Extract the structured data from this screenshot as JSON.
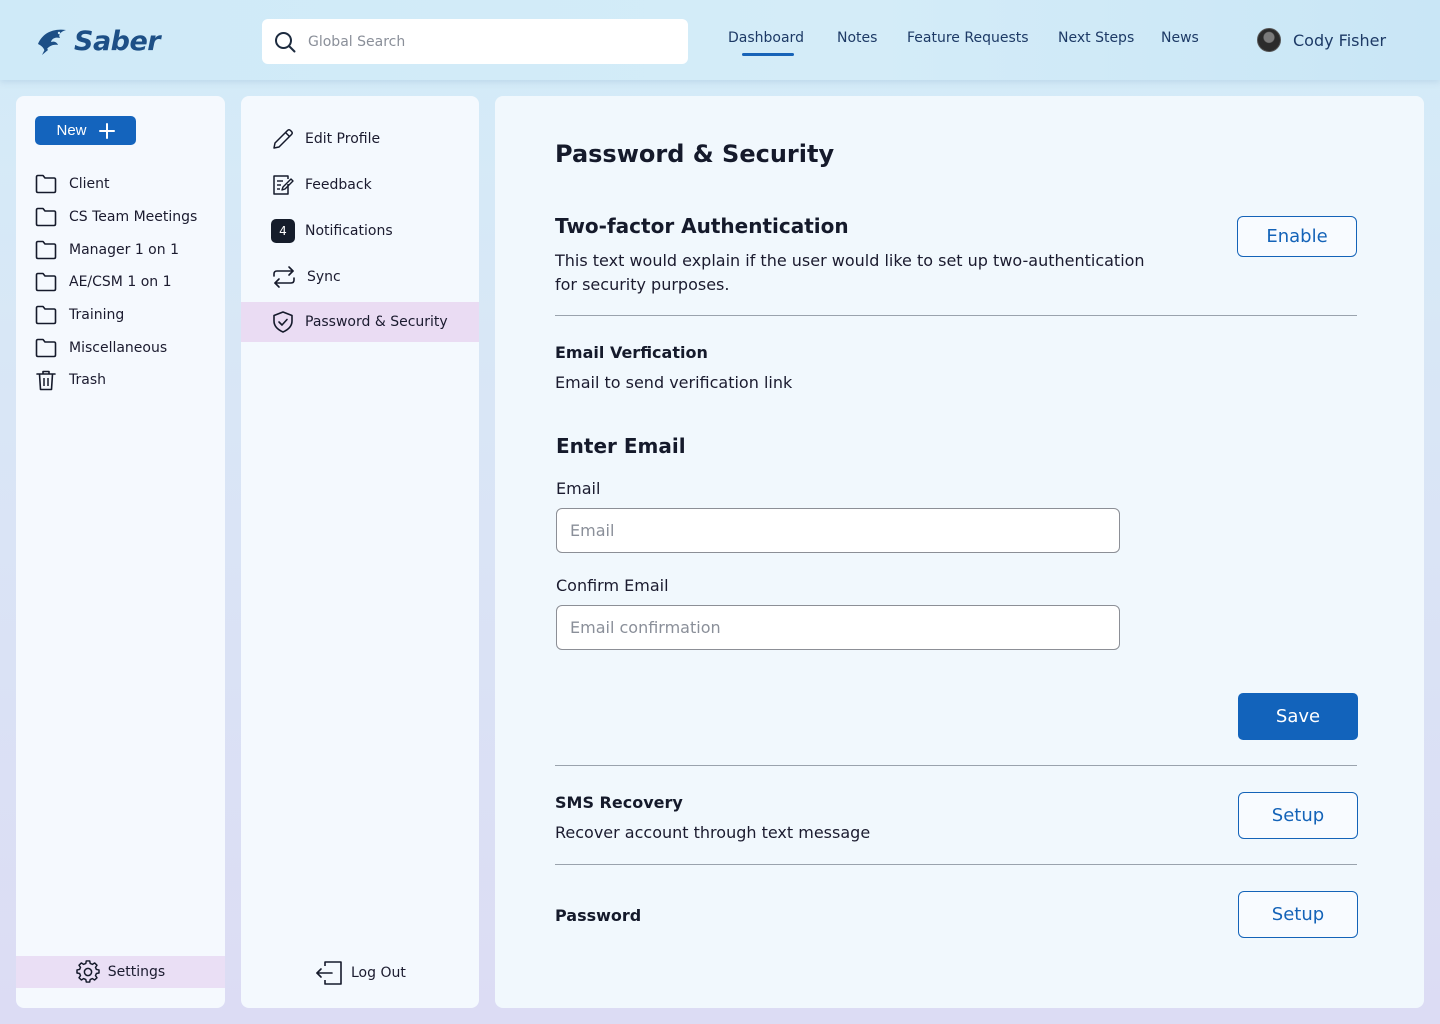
{
  "app": {
    "logo_text": "Saber",
    "brand_color": "#1d4f86",
    "accent_color": "#1464bd"
  },
  "search": {
    "placeholder": "Global Search",
    "icon": "search-icon"
  },
  "nav": {
    "items": [
      {
        "label": "Dashboard",
        "active": true
      },
      {
        "label": "Notes"
      },
      {
        "label": "Feature Requests"
      },
      {
        "label": "Next Steps"
      },
      {
        "label": "News"
      }
    ]
  },
  "user": {
    "name": "Cody Fisher"
  },
  "sidebar": {
    "new_label": "New",
    "folders": [
      {
        "label": "Client",
        "icon": "folder-icon"
      },
      {
        "label": "CS Team Meetings",
        "icon": "folder-icon"
      },
      {
        "label": "Manager 1 on 1",
        "icon": "folder-icon"
      },
      {
        "label": "AE/CSM 1 on 1",
        "icon": "folder-icon"
      },
      {
        "label": "Training",
        "icon": "folder-icon"
      },
      {
        "label": "Miscellaneous",
        "icon": "folder-icon"
      },
      {
        "label": "Trash",
        "icon": "trash-icon"
      }
    ],
    "settings_label": "Settings"
  },
  "settings_menu": {
    "items": [
      {
        "label": "Edit Profile",
        "icon": "pencil-icon"
      },
      {
        "label": "Feedback",
        "icon": "feedback-icon"
      },
      {
        "label": "Notifications",
        "badge": "4"
      },
      {
        "label": "Sync",
        "icon": "sync-icon"
      },
      {
        "label": "Password & Security",
        "icon": "shield-icon",
        "active": true
      }
    ],
    "logout_label": "Log Out"
  },
  "main": {
    "title": "Password & Security",
    "two_factor": {
      "heading": "Two-factor Authentication",
      "description_line1": "This text would explain if the user would like to set up two-authentication",
      "description_line2": "for security purposes.",
      "button": "Enable"
    },
    "email_verification": {
      "heading": "Email Verfication",
      "description": "Email to send verification link"
    },
    "enter_email": {
      "heading": "Enter Email",
      "email_label": "Email",
      "email_placeholder": "Email",
      "confirm_label": "Confirm Email",
      "confirm_placeholder": "Email confirmation",
      "save_button": "Save"
    },
    "sms_recovery": {
      "heading": "SMS Recovery",
      "description": "Recover account through text message",
      "button": "Setup"
    },
    "password": {
      "heading": "Password",
      "button": "Setup"
    }
  }
}
